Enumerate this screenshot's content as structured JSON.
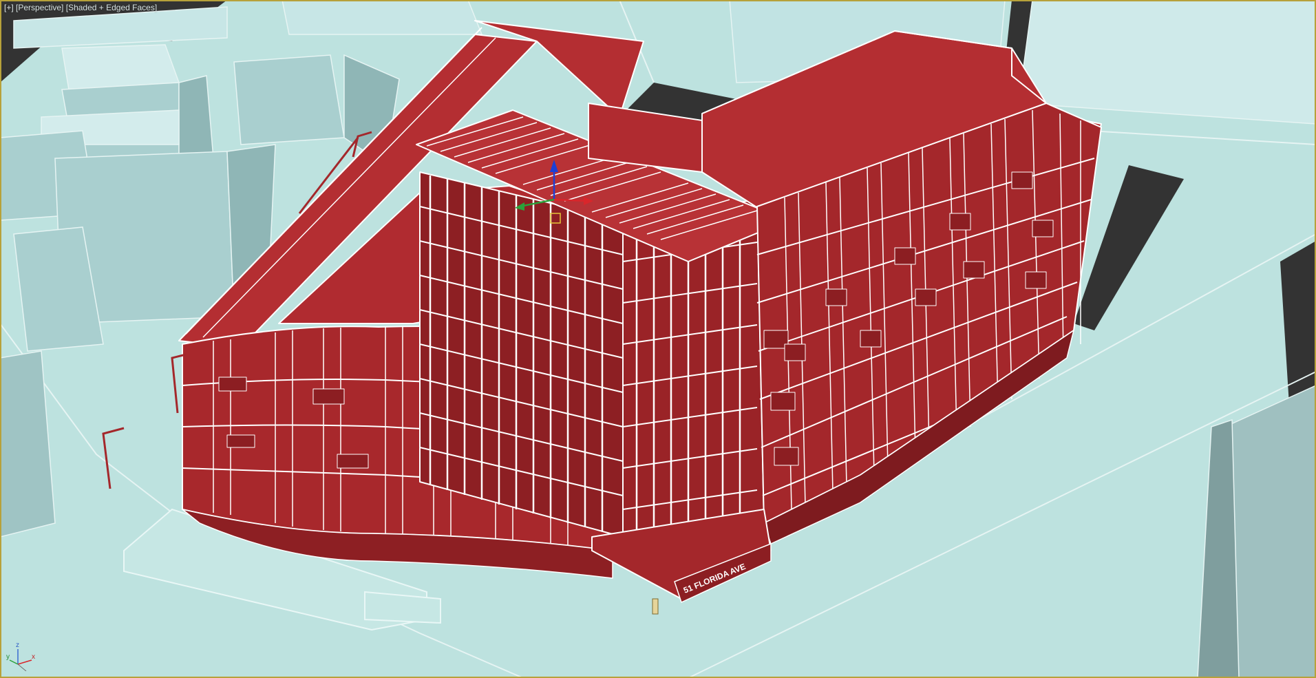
{
  "viewport": {
    "label_plus": "[+]",
    "label_view": "[Perspective]",
    "label_shading": "[Shaded + Edged Faces]"
  },
  "scene": {
    "selection_color": "#ad282c",
    "selection_edge_color": "#ffffff",
    "context_color": "#b9dcdc",
    "context_edge_color": "#e6f3f3",
    "ground_color": "#bde2df",
    "background_color": "#2f2f2f",
    "viewport_border_color": "#b7a13a",
    "storefront_sign": "51 FLORIDA AVE"
  },
  "gizmo": {
    "x_color": "#d9262b",
    "y_color": "#2ba23a",
    "z_color": "#1c3fd6"
  },
  "axis_tripod": {
    "x_label": "x",
    "y_label": "y",
    "z_label": "z"
  }
}
